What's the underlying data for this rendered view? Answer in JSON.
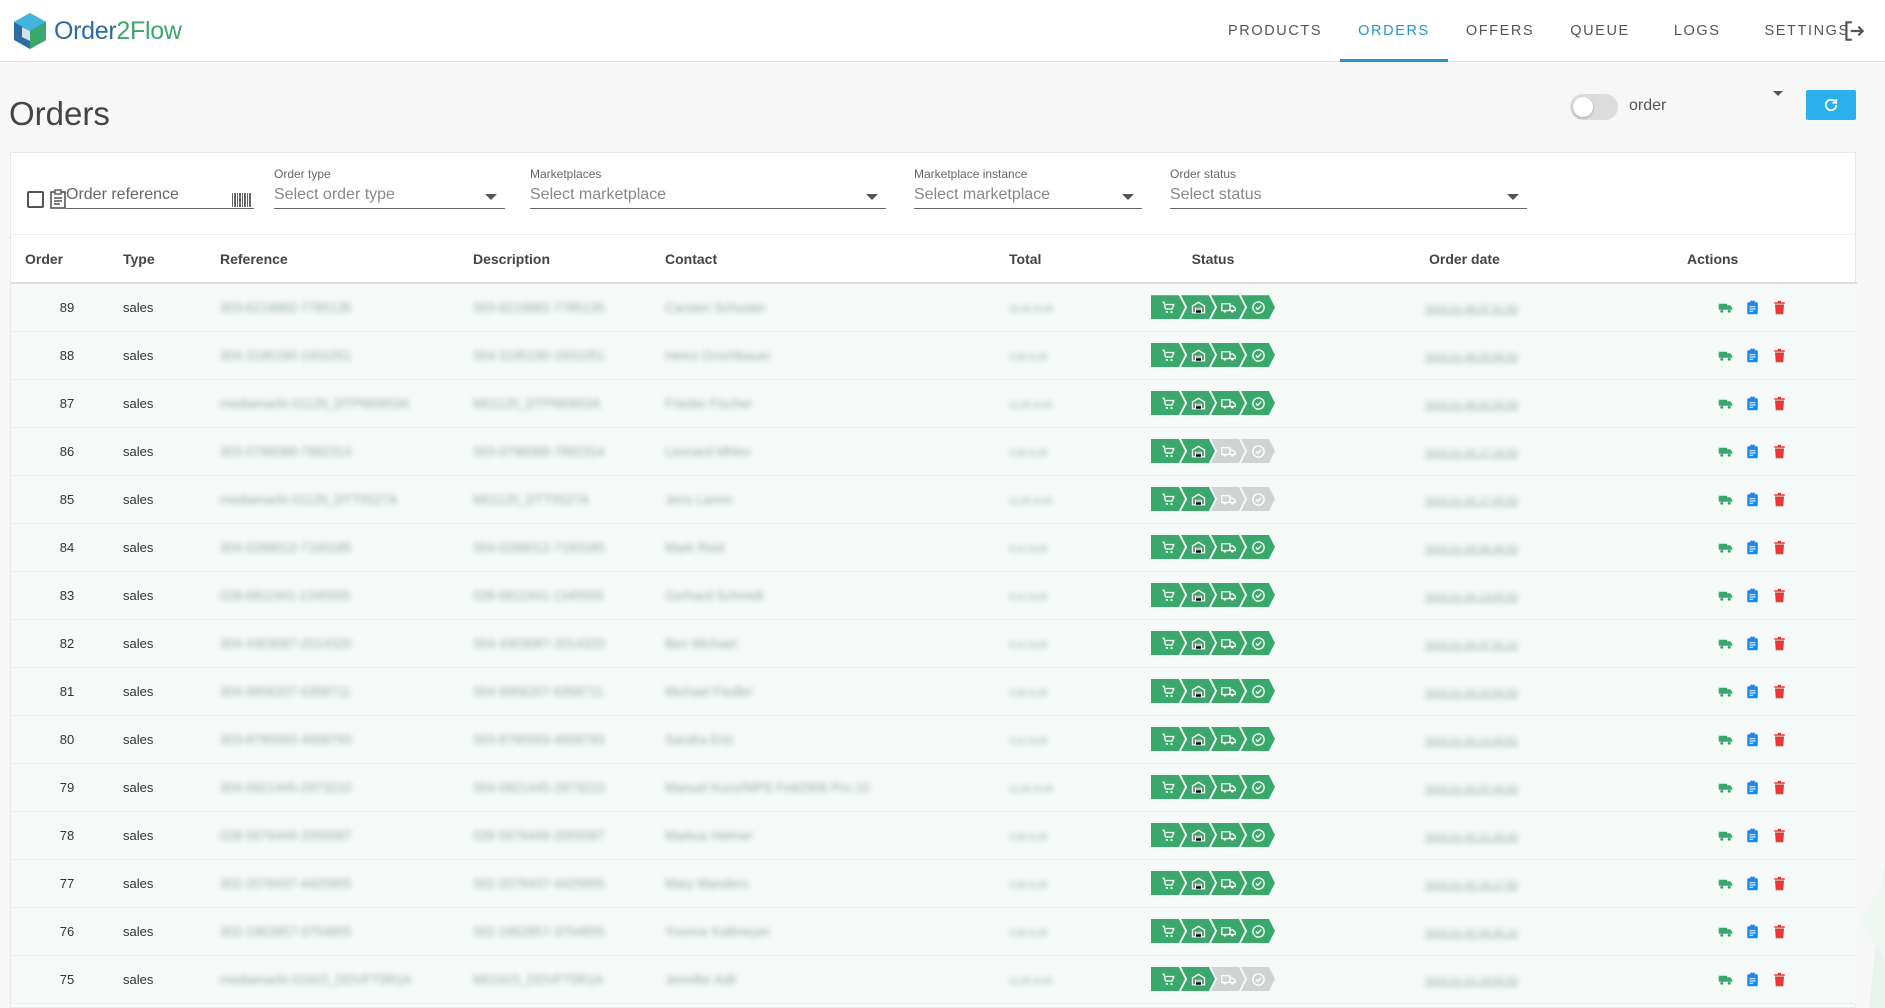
{
  "app": {
    "logo_part1": "Order",
    "logo_part2": "2Flow"
  },
  "nav": {
    "items": [
      {
        "label": "PRODUCTS",
        "active": false
      },
      {
        "label": "ORDERS",
        "active": true
      },
      {
        "label": "OFFERS",
        "active": false
      },
      {
        "label": "QUEUE",
        "active": false
      },
      {
        "label": "LOGS",
        "active": false
      },
      {
        "label": "SETTINGS",
        "active": false,
        "dropdown": true
      }
    ],
    "logout_icon": "logout-icon"
  },
  "page": {
    "title": "Orders",
    "toggle_label": "order",
    "toggle_on": false,
    "refresh_icon": "refresh-icon"
  },
  "filters": {
    "order_reference": {
      "label": "",
      "placeholder": "Order reference"
    },
    "order_type": {
      "label": "Order type",
      "placeholder": "Select order type"
    },
    "marketplaces": {
      "label": "Marketplaces",
      "placeholder": "Select marketplace"
    },
    "marketplace_instance": {
      "label": "Marketplace instance",
      "placeholder": "Select marketplace"
    },
    "order_status": {
      "label": "Order status",
      "placeholder": "Select status"
    }
  },
  "table": {
    "columns": [
      "Order",
      "Type",
      "Reference",
      "Description",
      "Contact",
      "Total",
      "Status",
      "Order date",
      "Actions"
    ],
    "status_steps": [
      "cart-icon",
      "warehouse-icon",
      "truck-icon",
      "check-circle-icon"
    ],
    "action_icons": [
      "truck-icon",
      "clipboard-icon",
      "trash-icon"
    ],
    "colors": {
      "status_done": "#3aa86b",
      "status_pending": "#cfd3d3",
      "action_ship": "#3aa86b",
      "action_info": "#1e88e5",
      "action_delete": "#e53935"
    },
    "rows": [
      {
        "order": "89",
        "type": "sales",
        "reference": "303-6219882-7785135",
        "description": "303-6219882-7785135",
        "contact": "Carsten Schuster",
        "total": "19,95 EUR",
        "status": [
          true,
          true,
          true,
          true
        ],
        "date": "2024-01-08 07:51:55"
      },
      {
        "order": "88",
        "type": "sales",
        "reference": "304-3195190-1931051",
        "description": "304-3195190-1931051",
        "contact": "Heinz Grochbauer",
        "total": "3,95 EUR",
        "status": [
          true,
          true,
          true,
          true
        ],
        "date": "2024-01-08 05:59:50"
      },
      {
        "order": "87",
        "type": "sales",
        "reference": "mediamarkt-01120_DTPM0953A",
        "description": "M01120_DTPM0953A",
        "contact": "Frieder Fischer",
        "total": "11,95 EUR",
        "status": [
          true,
          true,
          true,
          true
        ],
        "date": "2024-01-08 01:55:59"
      },
      {
        "order": "86",
        "type": "sales",
        "reference": "303-0796088-7892314",
        "description": "303-0796088-7892314",
        "contact": "Leonard Mhlev",
        "total": "3,95 EUR",
        "status": [
          true,
          true,
          false,
          false
        ],
        "date": "2024-01-05 17:19:55"
      },
      {
        "order": "85",
        "type": "sales",
        "reference": "mediamarkt-01120_DTT5527A",
        "description": "M01120_DTT5527A",
        "contact": "Jens Lamm",
        "total": "11,95 EUR",
        "status": [
          true,
          true,
          false,
          false
        ],
        "date": "2024-01-05 17:05:55"
      },
      {
        "order": "84",
        "type": "sales",
        "reference": "304-0288012-7193185",
        "description": "304-0288012-7193185",
        "contact": "Mark Reid",
        "total": "9,91 EUR",
        "status": [
          true,
          true,
          true,
          true
        ],
        "date": "2024-01-05 08:49:55"
      },
      {
        "order": "83",
        "type": "sales",
        "reference": "028-6811941-1345555",
        "description": "028-6811941-1345555",
        "contact": "Gerhard Schmidt",
        "total": "9,91 EUR",
        "status": [
          true,
          true,
          true,
          true
        ],
        "date": "2024-01-04 13:05:55"
      },
      {
        "order": "82",
        "type": "sales",
        "reference": "304-4303087-2014320",
        "description": "304-4303087-2014320",
        "contact": "Ben Michael",
        "total": "9,91 EUR",
        "status": [
          true,
          true,
          true,
          true
        ],
        "date": "2024-01-04 07:51:15"
      },
      {
        "order": "81",
        "type": "sales",
        "reference": "304-9956207-6358711",
        "description": "304-9956207-6358711",
        "contact": "Michael Fiedler",
        "total": "3,95 EUR",
        "status": [
          true,
          true,
          true,
          true
        ],
        "date": "2024-01-03 20:50:55"
      },
      {
        "order": "80",
        "type": "sales",
        "reference": "303-8795593-4658793",
        "description": "303-8795593-4658793",
        "contact": "Sandra Ertz",
        "total": "3,91 EUR",
        "status": [
          true,
          true,
          true,
          true
        ],
        "date": "2024-01-03 14:45:51"
      },
      {
        "order": "79",
        "type": "sales",
        "reference": "304-0921445-2973210",
        "description": "304-0921445-2973210",
        "contact": "Manuel Kunz/MPS Fett2906 Pro 10",
        "total": "13,95 EUR",
        "status": [
          true,
          true,
          true,
          true
        ],
        "date": "2024-01-03 07:43:05"
      },
      {
        "order": "78",
        "type": "sales",
        "reference": "028-5676449-2055587",
        "description": "028-5676449-2055587",
        "contact": "Markus Helmer",
        "total": "3,95 EUR",
        "status": [
          true,
          true,
          true,
          true
        ],
        "date": "2024-01-02 21:35:45"
      },
      {
        "order": "77",
        "type": "sales",
        "reference": "302-2078437-4425955",
        "description": "302-2078437-4425955",
        "contact": "Mary Manders",
        "total": "3,95 EUR",
        "status": [
          true,
          true,
          true,
          true
        ],
        "date": "2024-01-02 19:17:55"
      },
      {
        "order": "76",
        "type": "sales",
        "reference": "302-1962857-3754855",
        "description": "302-1962857-3754855",
        "contact": "Yvonne Kallmeyer",
        "total": "3,95 EUR",
        "status": [
          true,
          true,
          true,
          true
        ],
        "date": "2024-01-02 09:35:15"
      },
      {
        "order": "75",
        "type": "sales",
        "reference": "mediamarkt-01915_DDVFT5R1A",
        "description": "M01915_DDVFT5R1A",
        "contact": "Jennifer Adil",
        "total": "11,95 EUR",
        "status": [
          true,
          true,
          false,
          false
        ],
        "date": "2024-01-01 18:55:55"
      }
    ]
  }
}
